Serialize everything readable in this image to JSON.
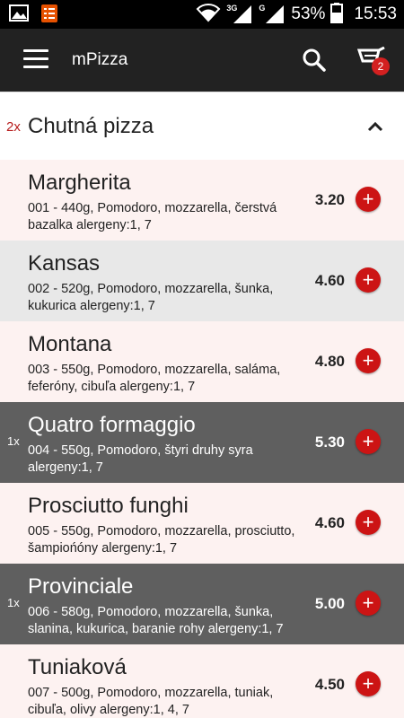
{
  "status_bar": {
    "network_3g": "3G",
    "network_g": "G",
    "battery_percent": "53%",
    "time": "15:53",
    "icons": [
      "image-icon",
      "notes-icon",
      "wifi-icon",
      "signal-icon",
      "signal-icon",
      "battery-icon"
    ]
  },
  "app_bar": {
    "title": "mPizza",
    "cart_count": "2",
    "icons": [
      "menu-icon",
      "search-icon",
      "cart-icon"
    ]
  },
  "section": {
    "count": "2x",
    "title": "Chutná pizza",
    "icon": "chevron-up-icon"
  },
  "colors": {
    "light_row": "#fdf2f1",
    "grey_row": "#e8e8e8",
    "selected_row": "#5f5f5f",
    "accent": "#cc1414",
    "app_bar": "#222222"
  },
  "items": [
    {
      "qty": "",
      "name": "Margherita",
      "desc": "001 - 440g, Pomodoro, mozzarella, čerstvá bazalka alergeny:1, 7",
      "price": "3.20",
      "add": "+"
    },
    {
      "qty": "",
      "name": "Kansas",
      "desc": "002 - 520g, Pomodoro, mozzarella, šunka, kukurica alergeny:1, 7",
      "price": "4.60",
      "add": "+"
    },
    {
      "qty": "",
      "name": "Montana",
      "desc": "003 - 550g, Pomodoro, mozzarella, saláma, feferóny, cibuľa alergeny:1, 7",
      "price": "4.80",
      "add": "+"
    },
    {
      "qty": "1x",
      "name": "Quatro formaggio",
      "desc": "004 - 550g, Pomodoro, štyri druhy syra alergeny:1, 7",
      "price": "5.30",
      "add": "+"
    },
    {
      "qty": "",
      "name": "Prosciutto funghi",
      "desc": "005 - 550g, Pomodoro, mozzarella, prosciutto, šampiońóny alergeny:1, 7",
      "price": "4.60",
      "add": "+"
    },
    {
      "qty": "1x",
      "name": "Provinciale",
      "desc": "006 - 580g, Pomodoro, mozzarella, šunka, slanina, kukurica, baranie rohy alergeny:1, 7",
      "price": "5.00",
      "add": "+"
    },
    {
      "qty": "",
      "name": "Tuniaková",
      "desc": "007 - 500g, Pomodoro, mozzarella, tuniak, cibuľa, olivy alergeny:1, 4, 7",
      "price": "4.50",
      "add": "+"
    }
  ]
}
